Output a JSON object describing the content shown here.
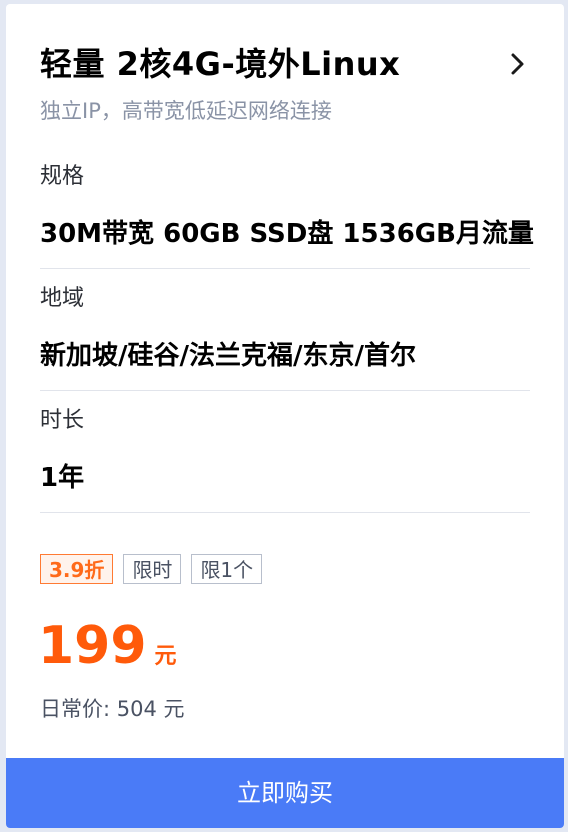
{
  "product": {
    "title": "轻量 2核4G-境外Linux",
    "subtitle": "独立IP，高带宽低延迟网络连接",
    "chevron_icon": "chevron-right-icon"
  },
  "specs": {
    "label": "规格",
    "value": "30M带宽 60GB SSD盘 1536GB月流量"
  },
  "region": {
    "label": "地域",
    "value": "新加坡/硅谷/法兰克福/东京/首尔"
  },
  "duration": {
    "label": "时长",
    "value": "1年"
  },
  "tags": [
    "3.9折",
    "限时",
    "限1个"
  ],
  "price": {
    "amount": "199",
    "unit": "元",
    "original": "日常价: 504 元"
  },
  "buy_button": {
    "label": "立即购买",
    "color": "#4a7bf7"
  },
  "colors": {
    "accent": "#ff5a0a",
    "discount_tag": "#ff6a1a"
  }
}
